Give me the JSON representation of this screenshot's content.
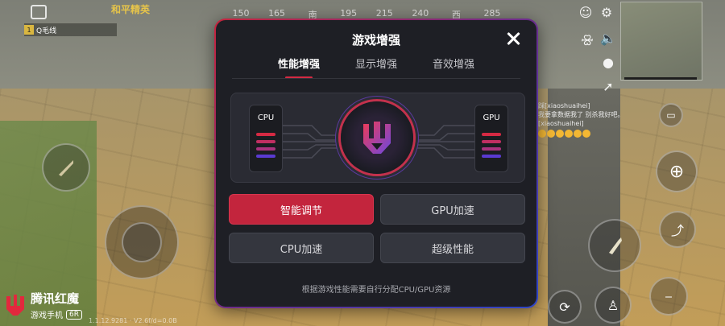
{
  "game": {
    "title": "和平精英",
    "compass": [
      "150",
      "165",
      "南",
      "195",
      "215",
      "240",
      "西",
      "285"
    ],
    "ally_label": "Q毛线",
    "chat_lines": [
      "踩[xiaoshuaihei]",
      "我要拿数据我了 别杀我好吧。",
      "[xiaoshuaihei]"
    ]
  },
  "dialog": {
    "title": "游戏增强",
    "tabs": [
      {
        "label": "性能增强",
        "active": true
      },
      {
        "label": "显示增强",
        "active": false
      },
      {
        "label": "音效增强",
        "active": false
      }
    ],
    "cpu_label": "CPU",
    "gpu_label": "GPU",
    "buttons": [
      {
        "label": "智能调节",
        "active": true
      },
      {
        "label": "GPU加速",
        "active": false
      },
      {
        "label": "CPU加速",
        "active": false
      },
      {
        "label": "超级性能",
        "active": false
      }
    ],
    "hint": "根据游戏性能需要自行分配CPU/GPU资源"
  },
  "watermark": {
    "brand": "腾讯红魔",
    "subtitle": "游戏手机",
    "model": "6R",
    "version": "1.1.12.9281 · V2.6f/d=0.0B"
  },
  "colors": {
    "accent_red": "#c3253d",
    "panel_bg": "#1e1f25",
    "button_bg": "#34363e",
    "bar_red": "#d42a43",
    "bar_pink": "#b6337c",
    "bar_purple": "#5a3ad0"
  },
  "icons": [
    "close-icon",
    "redmagic-logo-icon",
    "gear-icon",
    "emoji-icon",
    "microphone-icon",
    "speaker-icon",
    "crosshair-icon",
    "bullet-icon",
    "chat-icon",
    "sprint-icon",
    "crouch-icon",
    "prone-icon",
    "grenade-icon"
  ]
}
